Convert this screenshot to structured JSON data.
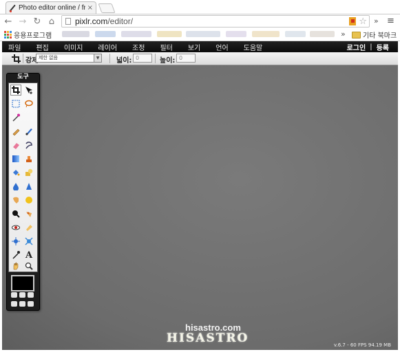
{
  "browser": {
    "tab_title": "Photo editor online / free",
    "tab_close": "×",
    "url_host": "pixlr.com",
    "url_path": "/editor/",
    "nav": {
      "back": "←",
      "forward": "→",
      "reload": "↻",
      "home": "⌂"
    },
    "ext_chevron": "»",
    "menu_glyph": "≡",
    "bookmarks": {
      "first_label": "응용프로그램",
      "chevron": "»",
      "other_label": "기타 북마크"
    }
  },
  "app": {
    "menu": [
      "파일",
      "편집",
      "이미지",
      "레이어",
      "조정",
      "필터",
      "보기",
      "언어",
      "도움말"
    ],
    "login": "로그인",
    "separator": "|",
    "register": "등록",
    "options": {
      "constraint_label": "강제:",
      "constraint_value": "제한 없음",
      "width_label": "넓이:",
      "width_value": "0",
      "height_label": "높이:",
      "height_value": "0"
    },
    "toolbox_title": "도구",
    "watermark_site": "hisastro.com",
    "watermark_logo": "HISASTRO",
    "status": "v.6.7 - 60 FPS 94.19 MB"
  },
  "colors": {
    "menubar": "#111111",
    "workspace": "#6d6d6d",
    "toolbox": "#1c1c1c",
    "foreground_color": "#000000"
  }
}
